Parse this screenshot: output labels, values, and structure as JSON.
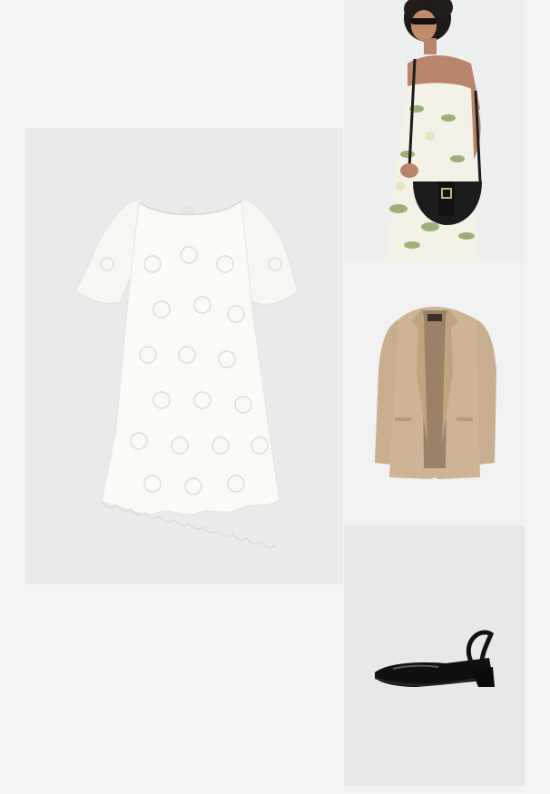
{
  "collage": {
    "items": [
      {
        "id": "dress",
        "name": "white-eyelet-dress-image"
      },
      {
        "id": "model",
        "name": "model-with-black-crossbody-bag-image"
      },
      {
        "id": "blazer",
        "name": "beige-blazer-image"
      },
      {
        "id": "shoe",
        "name": "black-patent-slingback-shoe-image"
      }
    ],
    "colors": {
      "page_background": "#f4f4f4",
      "tile_background": "#ebebeb",
      "dress": "#fafaf7",
      "blazer": "#cdb495",
      "bag": "#1c1c1c",
      "shoe": "#101010"
    }
  }
}
